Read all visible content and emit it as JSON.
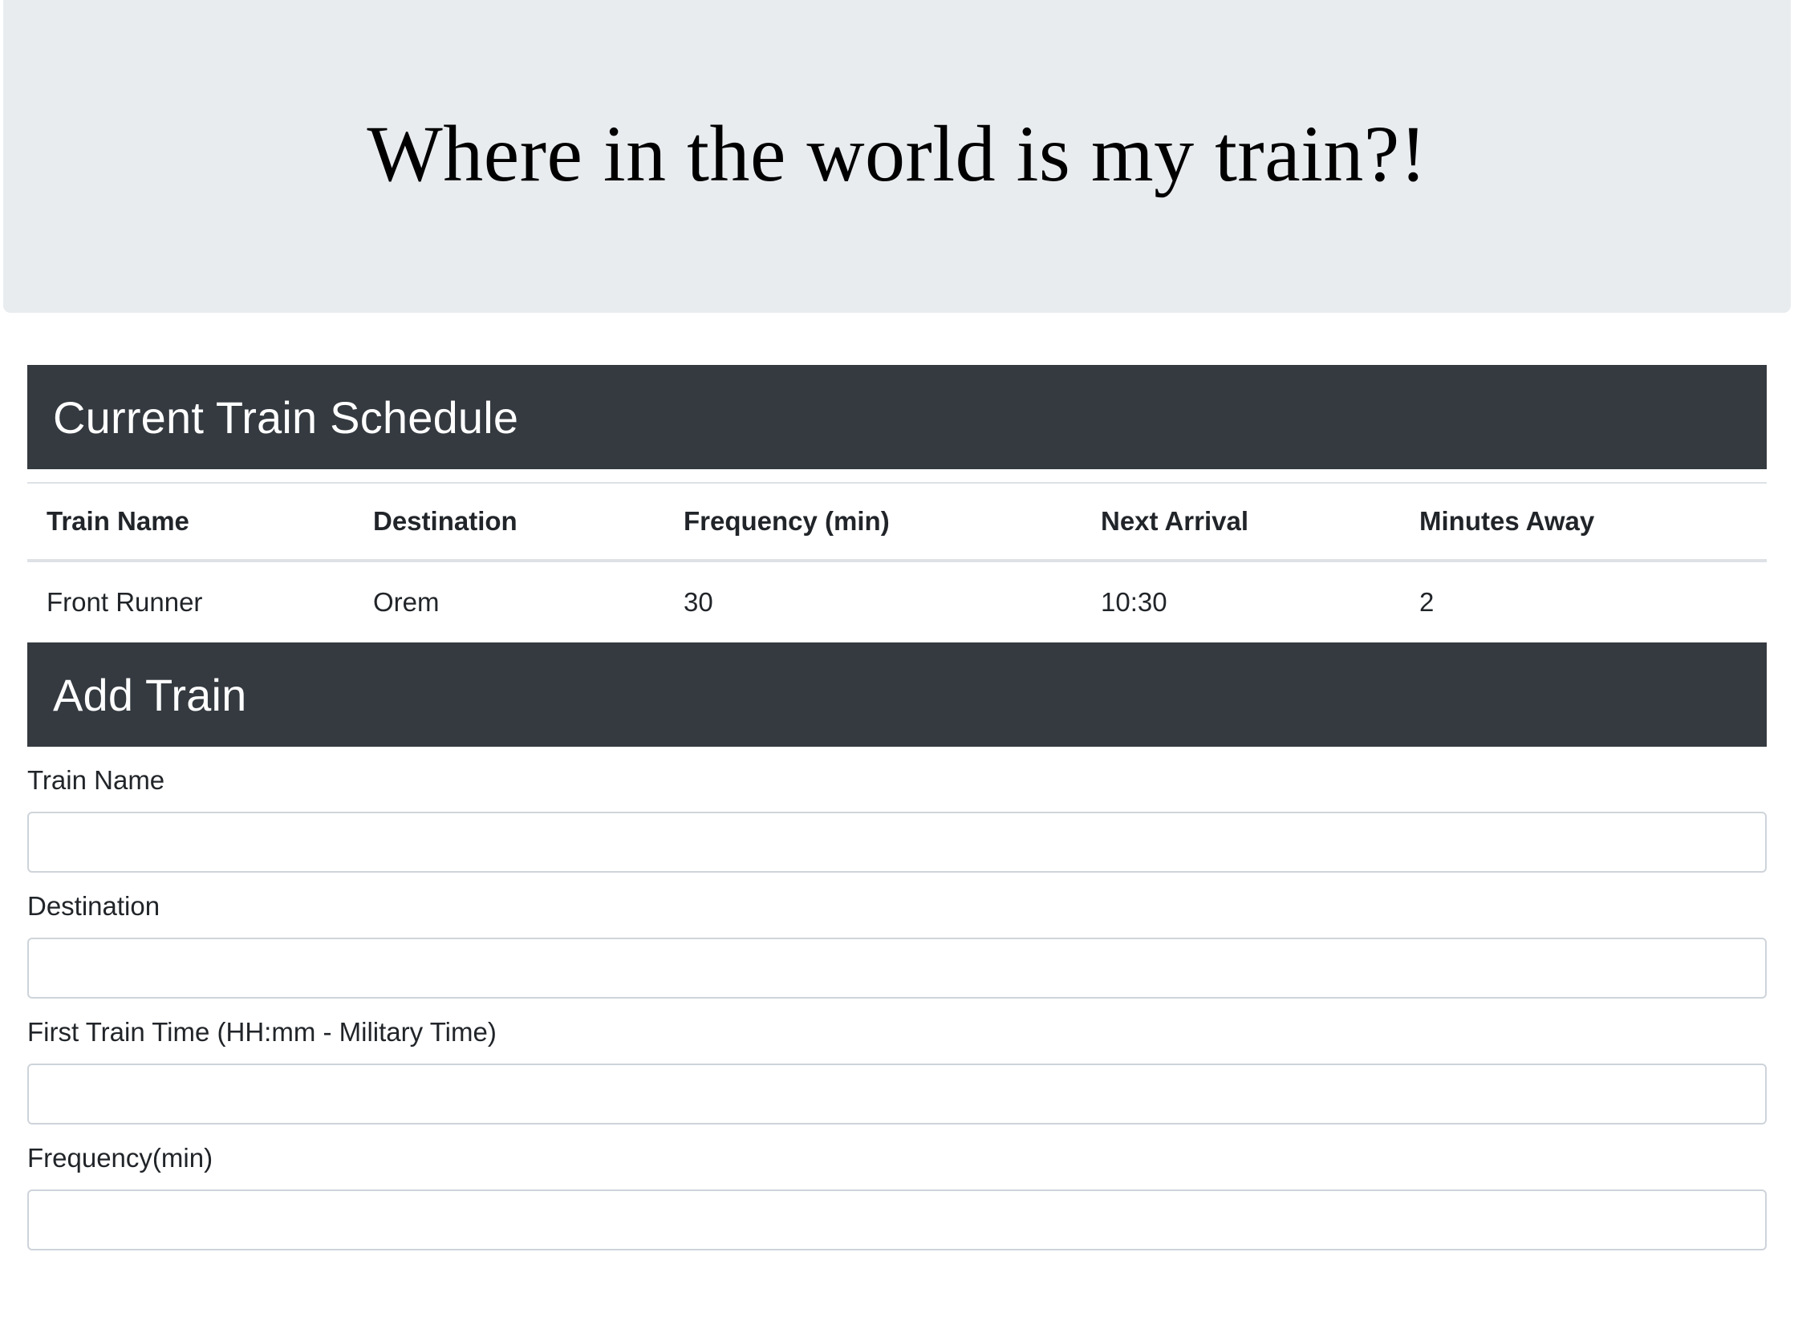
{
  "jumbotron": {
    "title": "Where in the world is my train?!"
  },
  "schedule": {
    "header": "Current Train Schedule",
    "columns": [
      "Train Name",
      "Destination",
      "Frequency (min)",
      "Next Arrival",
      "Minutes Away"
    ],
    "rows": [
      [
        "Front Runner",
        "Orem",
        "30",
        "10:30",
        "2"
      ]
    ]
  },
  "add_train": {
    "header": "Add Train",
    "fields": [
      {
        "label": "Train Name",
        "value": "",
        "placeholder": ""
      },
      {
        "label": "Destination",
        "value": "",
        "placeholder": ""
      },
      {
        "label": "First Train Time (HH:mm - Military Time)",
        "value": "",
        "placeholder": ""
      },
      {
        "label": "Frequency(min)",
        "value": "",
        "placeholder": ""
      }
    ]
  },
  "colors": {
    "jumbotron_bg": "#e9ecef",
    "header_bg": "#343a40",
    "header_text": "#ffffff"
  }
}
